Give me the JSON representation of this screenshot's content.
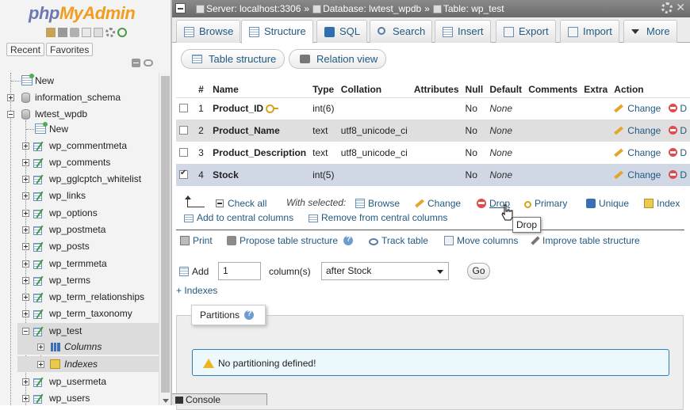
{
  "nav": {
    "logo_php": "php",
    "logo_my": "My",
    "logo_admin": "Admin",
    "recent_label": "Recent",
    "favorites_label": "Favorites",
    "tree": [
      {
        "label": "New",
        "level": 0,
        "kind": "new"
      },
      {
        "label": "information_schema",
        "level": 0,
        "kind": "db"
      },
      {
        "label": "lwtest_wpdb",
        "level": 0,
        "kind": "db-open"
      },
      {
        "label": "New",
        "level": 1,
        "kind": "newtable"
      },
      {
        "label": "wp_commentmeta",
        "level": 1,
        "kind": "table"
      },
      {
        "label": "wp_comments",
        "level": 1,
        "kind": "table"
      },
      {
        "label": "wp_gglcptch_whitelist",
        "level": 1,
        "kind": "table"
      },
      {
        "label": "wp_links",
        "level": 1,
        "kind": "table"
      },
      {
        "label": "wp_options",
        "level": 1,
        "kind": "table"
      },
      {
        "label": "wp_postmeta",
        "level": 1,
        "kind": "table"
      },
      {
        "label": "wp_posts",
        "level": 1,
        "kind": "table"
      },
      {
        "label": "wp_termmeta",
        "level": 1,
        "kind": "table"
      },
      {
        "label": "wp_terms",
        "level": 1,
        "kind": "table"
      },
      {
        "label": "wp_term_relationships",
        "level": 1,
        "kind": "table"
      },
      {
        "label": "wp_term_taxonomy",
        "level": 1,
        "kind": "table"
      },
      {
        "label": "wp_test",
        "level": 1,
        "kind": "table-open"
      },
      {
        "label": "Columns",
        "level": 2,
        "kind": "columns"
      },
      {
        "label": "Indexes",
        "level": 2,
        "kind": "indexes"
      },
      {
        "label": "wp_usermeta",
        "level": 1,
        "kind": "table"
      },
      {
        "label": "wp_users",
        "level": 1,
        "kind": "table"
      }
    ]
  },
  "breadcrumb": {
    "server": "Server: localhost:3306",
    "database": "Database: lwtest_wpdb",
    "table": "Table: wp_test",
    "sep": "»"
  },
  "tabs": [
    {
      "label": "Browse",
      "icon": "grid"
    },
    {
      "label": "Structure",
      "icon": "structure",
      "active": true
    },
    {
      "label": "SQL",
      "icon": "sql"
    },
    {
      "label": "Search",
      "icon": "search"
    },
    {
      "label": "Insert",
      "icon": "insert"
    },
    {
      "label": "Export",
      "icon": "export"
    },
    {
      "label": "Import",
      "icon": "import"
    },
    {
      "label": "More",
      "icon": "more"
    }
  ],
  "subtabs": {
    "table_structure": "Table structure",
    "relation_view": "Relation view"
  },
  "table": {
    "headers": [
      "#",
      "Name",
      "Type",
      "Collation",
      "Attributes",
      "Null",
      "Default",
      "Comments",
      "Extra",
      "Action"
    ],
    "rows": [
      {
        "num": "1",
        "name": "Product_ID",
        "primary": true,
        "type": "int(6)",
        "collation": "",
        "attributes": "",
        "null": "No",
        "default": "None",
        "comments": "",
        "extra": "",
        "checked": false
      },
      {
        "num": "2",
        "name": "Product_Name",
        "primary": false,
        "type": "text",
        "collation": "utf8_unicode_ci",
        "attributes": "",
        "null": "No",
        "default": "None",
        "comments": "",
        "extra": "",
        "checked": false
      },
      {
        "num": "3",
        "name": "Product_Description",
        "primary": false,
        "type": "text",
        "collation": "utf8_unicode_ci",
        "attributes": "",
        "null": "No",
        "default": "None",
        "comments": "",
        "extra": "",
        "checked": false
      },
      {
        "num": "4",
        "name": "Stock",
        "primary": false,
        "type": "int(5)",
        "collation": "",
        "attributes": "",
        "null": "No",
        "default": "None",
        "comments": "",
        "extra": "",
        "checked": true
      }
    ],
    "change_label": "Change",
    "drop_label": "D"
  },
  "bulk": {
    "check_all": "Check all",
    "with_selected": "With selected:",
    "browse": "Browse",
    "change": "Change",
    "drop": "Drop",
    "primary": "Primary",
    "unique": "Unique",
    "index": "Index",
    "add_central": "Add to central columns",
    "remove_central": "Remove from central columns"
  },
  "tools": {
    "print": "Print",
    "propose": "Propose table structure",
    "track": "Track table",
    "move": "Move columns",
    "improve": "Improve table structure"
  },
  "add_column": {
    "label": "Add",
    "count": "1",
    "columns_label": "column(s)",
    "position": "after Stock",
    "go": "Go"
  },
  "indexes_link": "+ Indexes",
  "partitions": {
    "legend": "Partitions",
    "notice": "No partitioning defined!"
  },
  "tooltip": "Drop",
  "console": "Console",
  "colors": {
    "link": "#235a81",
    "topbar": "#7a7a7a",
    "row_even": "#dfdfdf",
    "row_marked": "#cfd8e4",
    "notice_border": "#2e7fb8",
    "logo_php": "#6c78af",
    "logo_myadmin": "#f29d1f"
  }
}
